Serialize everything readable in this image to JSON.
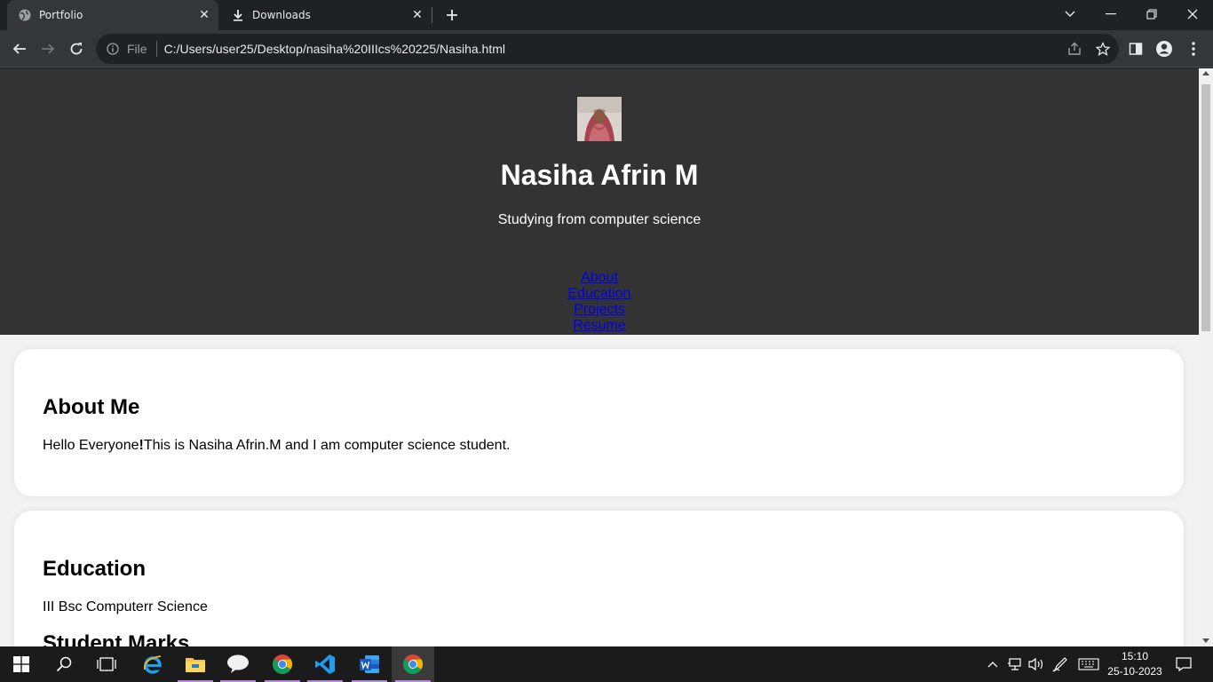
{
  "browser": {
    "tabs": [
      {
        "title": "Portfolio",
        "active": true,
        "icon": "globe-icon"
      },
      {
        "title": "Downloads",
        "active": false,
        "icon": "download-icon"
      }
    ],
    "omnibox": {
      "scheme_label": "File",
      "url": "C:/Users/user25/Desktop/nasiha%20IIIcs%20225/Nasiha.html"
    }
  },
  "page": {
    "header": {
      "name": "Nasiha Afrin M",
      "tagline": "Studying from computer science",
      "nav": [
        "About",
        "Education",
        "Projects",
        "Resume"
      ]
    },
    "about": {
      "heading": "About Me",
      "text_prefix": "Hello Everyone",
      "text_bang": "!",
      "text_suffix": "This is Nasiha Afrin.M and I am computer science student."
    },
    "education": {
      "heading": "Education",
      "degree": "III Bsc Computerr Science",
      "subheading": "Student Marks"
    }
  },
  "taskbar": {
    "time": "15:10",
    "date": "25-10-2023"
  },
  "colors": {
    "header_bg": "#333333",
    "page_bg": "#f2f2f2",
    "link": "#0000ee",
    "browser_dark": "#202124",
    "taskbar_accent": "#b28ed8"
  }
}
